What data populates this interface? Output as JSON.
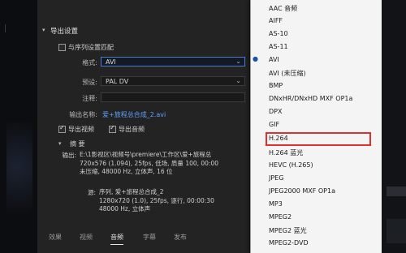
{
  "panel": {
    "title": "导出设置",
    "match_sequence": "与序列设置匹配",
    "format_label": "格式:",
    "format_value": "AVI",
    "preset_label": "预设:",
    "preset_value": "PAL DV",
    "comment_label": "注释:",
    "output_name_label": "输出名称:",
    "output_name_value": "爱+旅程总合成_2.avi",
    "export_video": "导出视频",
    "export_audio": "导出音频",
    "summary_title": "摘 要",
    "output_label": "输出:",
    "output_lines": [
      "E:\\1影视区\\视频号\\premiere\\工作区\\爱+旅程总",
      "720x576 (1.094), 25fps, 低场, 质量 100, 00:00",
      "未压缩, 48000 Hz, 立体声, 16 位"
    ],
    "source_label": "源:",
    "source_lines": [
      "序列, 爱+旅程总合成_2",
      "1280x720 (1.0), 25fps, 逐行, 00:00:30",
      "48000 Hz, 立体声"
    ],
    "tabs": [
      "效果",
      "视频",
      "音频",
      "字幕",
      "发布"
    ],
    "active_tab": 2
  },
  "dropdown": {
    "items": [
      "AAC 音频",
      "AIFF",
      "AS-10",
      "AS-11",
      "AVI",
      "AVI (未压缩)",
      "BMP",
      "DNxHR/DNxHD MXF OP1a",
      "DPX",
      "GIF",
      "H.264",
      "H.264 蓝光",
      "HEVC (H.265)",
      "JPEG",
      "JPEG2000 MXF OP1a",
      "MP3",
      "MPEG2",
      "MPEG2 蓝光",
      "MPEG2-DVD"
    ],
    "selected_item": "AVI",
    "highlighted_item": "H.264",
    "highlight_color": "#e0302c"
  },
  "colors": {
    "panel_bg": "#232323",
    "link": "#5ea0ff",
    "dropdown_bg": "#f4f4f4"
  }
}
